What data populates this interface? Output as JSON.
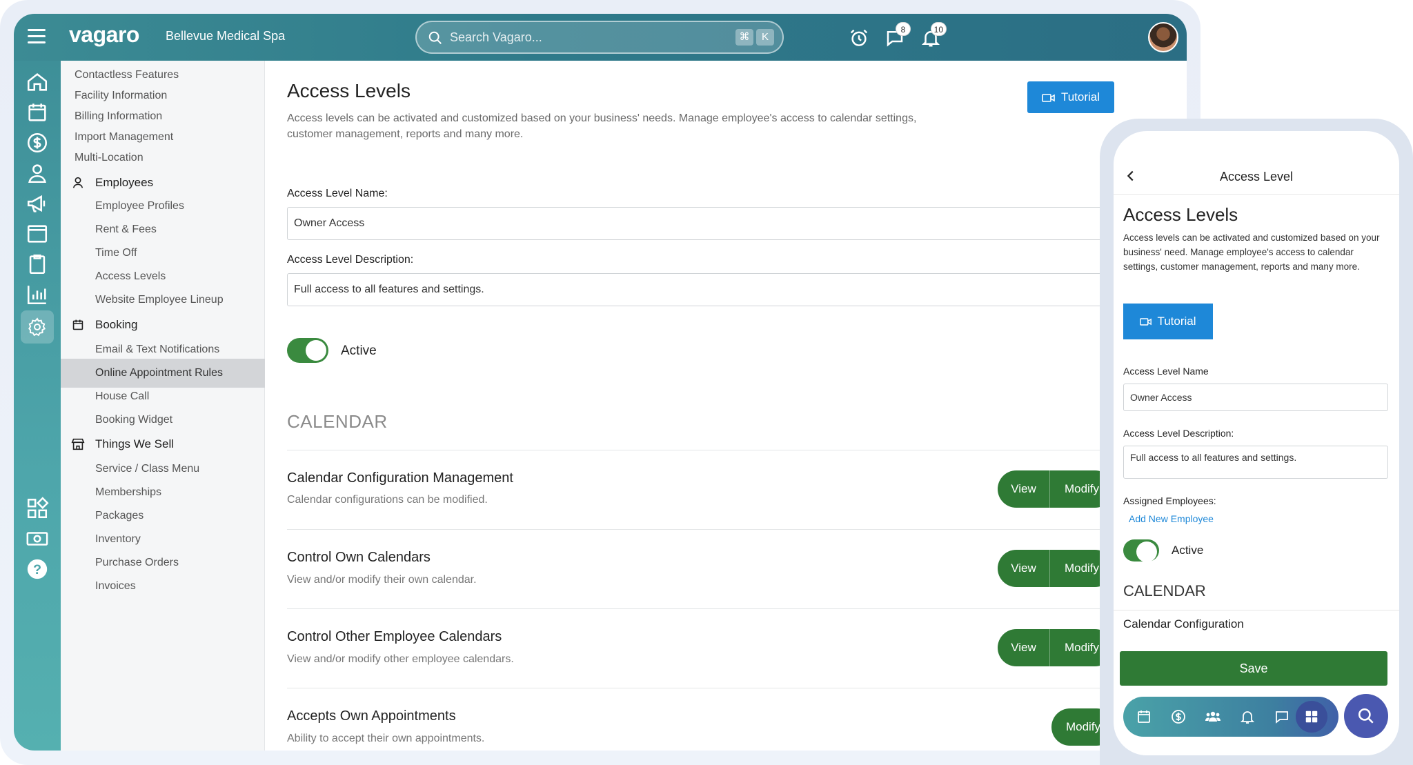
{
  "header": {
    "brand": "vagaro",
    "business_name": "Bellevue Medical Spa",
    "search_placeholder": "Search Vagaro...",
    "search_shortcut": [
      "⌘",
      "K"
    ],
    "messages_badge": "8",
    "notifications_badge": "10"
  },
  "rail_icons": [
    "home-icon",
    "calendar-icon",
    "dollar-icon",
    "user-icon",
    "megaphone-icon",
    "browser-icon",
    "clipboard-icon",
    "bar-chart-icon",
    "gear-icon",
    "apps-icon",
    "money-icon",
    "help-icon"
  ],
  "sidebar": {
    "items": [
      {
        "label": "Contactless Features",
        "level": 1
      },
      {
        "label": "Facility Information",
        "level": 1
      },
      {
        "label": "Billing Information",
        "level": 1
      },
      {
        "label": "Import Management",
        "level": 1
      },
      {
        "label": "Multi-Location",
        "level": 1
      },
      {
        "label": "Employees",
        "level": "section",
        "icon": "person-icon"
      },
      {
        "label": "Employee Profiles",
        "level": 2
      },
      {
        "label": "Rent & Fees",
        "level": 2
      },
      {
        "label": "Time Off",
        "level": 2
      },
      {
        "label": "Access Levels",
        "level": 2
      },
      {
        "label": "Website Employee Lineup",
        "level": 2
      },
      {
        "label": "Booking",
        "level": "section",
        "icon": "calendar-icon"
      },
      {
        "label": "Email & Text Notifications",
        "level": 2
      },
      {
        "label": "Online Appointment Rules",
        "level": 2,
        "selected": true
      },
      {
        "label": "House Call",
        "level": 2
      },
      {
        "label": "Booking Widget",
        "level": 2
      },
      {
        "label": "Things We Sell",
        "level": "section",
        "icon": "store-icon"
      },
      {
        "label": "Service / Class Menu",
        "level": 2
      },
      {
        "label": "Memberships",
        "level": 2
      },
      {
        "label": "Packages",
        "level": 2
      },
      {
        "label": "Inventory",
        "level": 2
      },
      {
        "label": "Purchase Orders",
        "level": 2
      },
      {
        "label": "Invoices",
        "level": 2
      }
    ]
  },
  "main": {
    "title": "Access Levels",
    "description": "Access levels can be activated and customized based on your business' needs. Manage employee's access to calendar settings, customer management, reports and many more.",
    "tutorial_label": "Tutorial",
    "name_label": "Access Level Name:",
    "name_value": "Owner Access",
    "desc_label": "Access Level Description:",
    "desc_value": "Full access to all features and settings.",
    "active_label": "Active",
    "active": true,
    "section_title": "CALENDAR",
    "permissions": [
      {
        "title": "Calendar Configuration Management",
        "desc": "Calendar configurations can be modified.",
        "view": "View",
        "modify": "Modify"
      },
      {
        "title": "Control Own Calendars",
        "desc": "View and/or modify their own calendar.",
        "view": "View",
        "modify": "Modify"
      },
      {
        "title": "Control Other Employee Calendars",
        "desc": "View and/or modify other employee calendars.",
        "view": "View",
        "modify": "Modify"
      },
      {
        "title": "Accepts Own Appointments",
        "desc": "Ability to accept their own appointments.",
        "modify": "Modify"
      }
    ]
  },
  "mobile": {
    "header_title": "Access Level",
    "title": "Access Levels",
    "description": "Access levels can be activated and customized based on your business' need. Manage employee's access to calendar settings, customer management, reports and many more.",
    "tutorial_label": "Tutorial",
    "name_label": "Access Level Name",
    "name_value": "Owner Access",
    "desc_label": "Access Level Description:",
    "desc_value": "Full access to all features and settings.",
    "assigned_label": "Assigned Employees:",
    "add_employee_link": "Add New Employee",
    "active_label": "Active",
    "section_title": "CALENDAR",
    "first_row": "Calendar Configuration",
    "save_label": "Save",
    "tabs": [
      "calendar-icon",
      "dollar-icon",
      "people-icon",
      "bell-icon",
      "chat-icon",
      "apps-icon"
    ]
  },
  "colors": {
    "header_teal": "#2f7a8a",
    "primary_green": "#2f7a35",
    "tutorial_blue": "#1e88d8",
    "selected_nav": "#d3d5d8"
  }
}
